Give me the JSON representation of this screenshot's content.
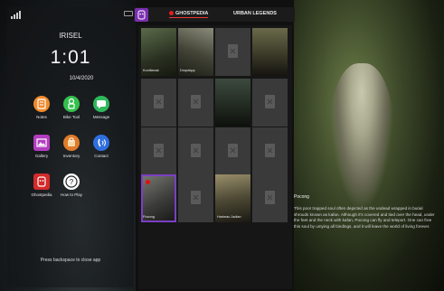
{
  "status": {
    "signal": "signal-bars-icon"
  },
  "phone": {
    "username": "IRISEL",
    "time": "1:01",
    "date": "10/4/2020",
    "apps": [
      {
        "label": "Notes",
        "icon": "notes-icon",
        "color": "#f08a2c"
      },
      {
        "label": "Bike Tool",
        "icon": "bike-tool-icon",
        "color": "#33c04d"
      },
      {
        "label": "Message",
        "icon": "message-icon",
        "color": "#2fb85c"
      },
      {
        "label": "Gallery",
        "icon": "gallery-icon",
        "color": "#b23cc0"
      },
      {
        "label": "Inventory",
        "icon": "inventory-icon",
        "color": "#e07c2a"
      },
      {
        "label": "Contact",
        "icon": "contact-icon",
        "color": "#2f6fe0"
      },
      {
        "label": "Ghostpedia",
        "icon": "ghostpedia-icon",
        "color": "#d32a2a"
      },
      {
        "label": "How to Play",
        "icon": "how-to-play-icon",
        "color": "#ffffff"
      }
    ],
    "hint": "Press backspace to close app"
  },
  "tabs": {
    "ghostpedia": "GHOSTPEDIA",
    "urban_legends": "URBAN LEGENDS"
  },
  "grid": {
    "captions": {
      "kuntilanak": "Kuntilanak",
      "dropdapp": "Dropdapp",
      "pocong": "Pocong",
      "harimau": "Harimau Jadian"
    }
  },
  "detail": {
    "title": "Pocong",
    "body": "This poor trapped soul often depicted as the undead wrapped in burial shrouds known as kafan. Although it's covered and tied over the head, under the feet and the neck with kafan, Pocong can fly and teleport. One can free this soul by untying all bindings, and it will leave the world of living forever."
  },
  "colors": {
    "accent": "#7b3fc4",
    "active_dot": "#e02020"
  }
}
